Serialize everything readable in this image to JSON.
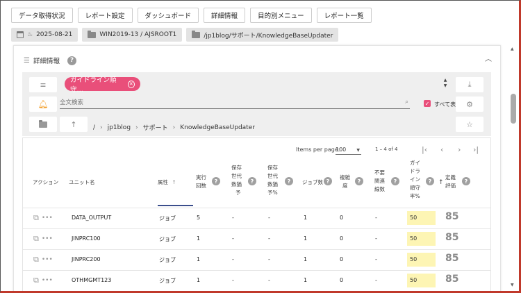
{
  "nav": {
    "buttons": [
      "データ取得状況",
      "レポート設定",
      "ダッシュボード",
      "詳細情報",
      "目的別メニュー",
      "レポート一覧"
    ]
  },
  "chips": {
    "date": "2025-08-21",
    "host": "WIN2019-13 / AJSROOT1",
    "path": "/jp1blog/サポート/KnowledgeBaseUpdater"
  },
  "panel": {
    "title": "詳細情報",
    "filter_tag": "ガイドライン順守…",
    "search_placeholder": "全文検索",
    "show_all_label": "すべて表示",
    "breadcrumb": [
      "/",
      "jp1blog",
      "サポート",
      "KnowledgeBaseUpdater"
    ]
  },
  "pager": {
    "items_per_page_label": "Items per page:",
    "items_per_page_value": "100",
    "range": "1 – 4 of 4"
  },
  "table": {
    "headers": {
      "action": "アクション",
      "unit": "ユニット名",
      "attr": "属性",
      "runs": [
        "実行",
        "回数"
      ],
      "gens": [
        "保存",
        "世代",
        "数猶",
        "予"
      ],
      "gens_pct": [
        "保存",
        "世代",
        "数猶",
        "予%"
      ],
      "jobs": "ジョブ数",
      "complexity": [
        "複雑",
        "度"
      ],
      "unneeded": [
        "不要",
        "関連",
        "線数"
      ],
      "guideline": [
        "ガイ",
        "ドラ",
        "イン",
        "順守",
        "率%"
      ],
      "score": [
        "定義",
        "評価"
      ]
    },
    "rows": [
      {
        "unit": "DATA_OUTPUT",
        "attr": "ジョブ",
        "runs": "5",
        "gens": "-",
        "gens_pct": "-",
        "jobs": "1",
        "complexity": "0",
        "unneeded": "-",
        "rate": "50",
        "score": "85"
      },
      {
        "unit": "JINPRC100",
        "attr": "ジョブ",
        "runs": "1",
        "gens": "-",
        "gens_pct": "-",
        "jobs": "1",
        "complexity": "0",
        "unneeded": "-",
        "rate": "50",
        "score": "85"
      },
      {
        "unit": "JINPRC200",
        "attr": "ジョブ",
        "runs": "1",
        "gens": "-",
        "gens_pct": "-",
        "jobs": "1",
        "complexity": "0",
        "unneeded": "-",
        "rate": "50",
        "score": "85"
      },
      {
        "unit": "OTHMGMT123",
        "attr": "ジョブ",
        "runs": "1",
        "gens": "-",
        "gens_pct": "-",
        "jobs": "1",
        "complexity": "0",
        "unneeded": "-",
        "rate": "50",
        "score": "85"
      }
    ]
  },
  "colors": {
    "accent": "#e94f7a",
    "sort_underline": "#3b4e8c",
    "rate_highlight": "#fdf5b4"
  }
}
